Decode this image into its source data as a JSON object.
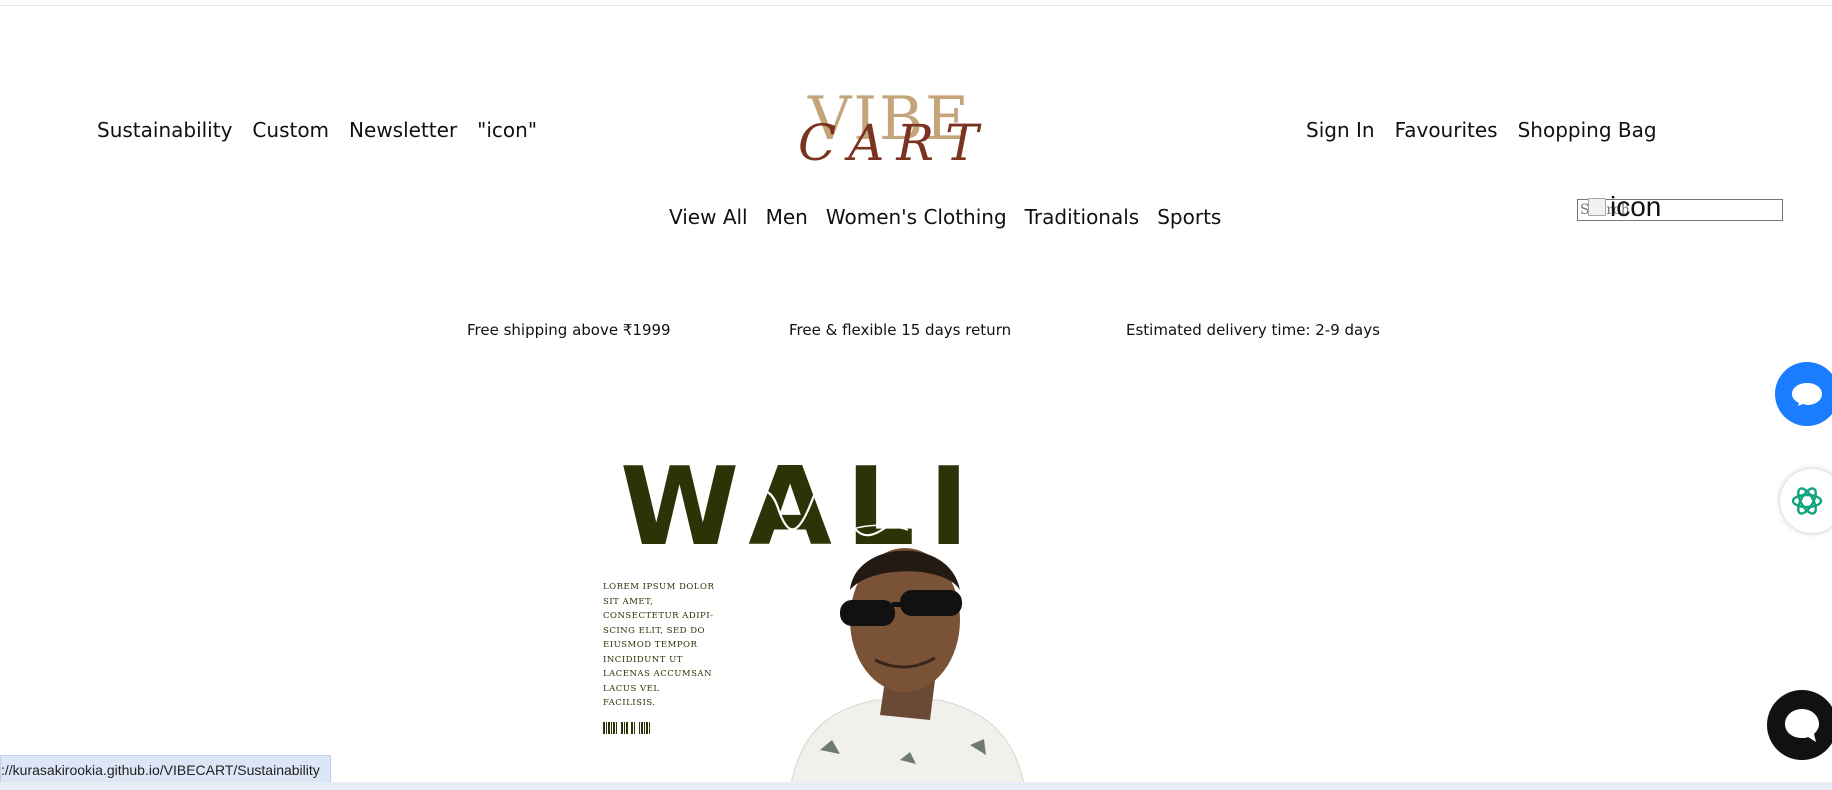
{
  "header": {
    "left_links": [
      "Sustainability",
      "Custom",
      "Newsletter",
      "\"icon\""
    ],
    "right_links": [
      "Sign In",
      "Favourites",
      "Shopping Bag"
    ],
    "logo": {
      "line1": "VIBE",
      "line2": "CART"
    }
  },
  "categories": [
    "View All",
    "Men",
    "Women's Clothing",
    "Traditionals",
    "Sports"
  ],
  "search": {
    "placeholder": "Search",
    "broken_image_alt": "icon"
  },
  "info": {
    "shipping": "Free shipping above ₹1999",
    "returns": "Free & flexible 15 days return",
    "delivery": "Estimated delivery time: 2-9 days"
  },
  "hero": {
    "title": "WALI",
    "lorem": "LOREM IPSUM DOLOR SIT AMET, CONSECTETUR ADIPI-SCING ELIT, SED DO EIUSMOD TEMPOR INCIDIDUNT UT LACENAS ACCUMSAN LACUS VEL FACILISIS.",
    "accent_color": "#2b3406"
  },
  "widgets": {
    "chat_color": "#1a7cff",
    "ai_color": "#10a37f",
    "dark_chat_color": "#111111"
  },
  "status_bar": {
    "url": "://kurasakirookia.github.io/VIBECART/Sustainability"
  }
}
